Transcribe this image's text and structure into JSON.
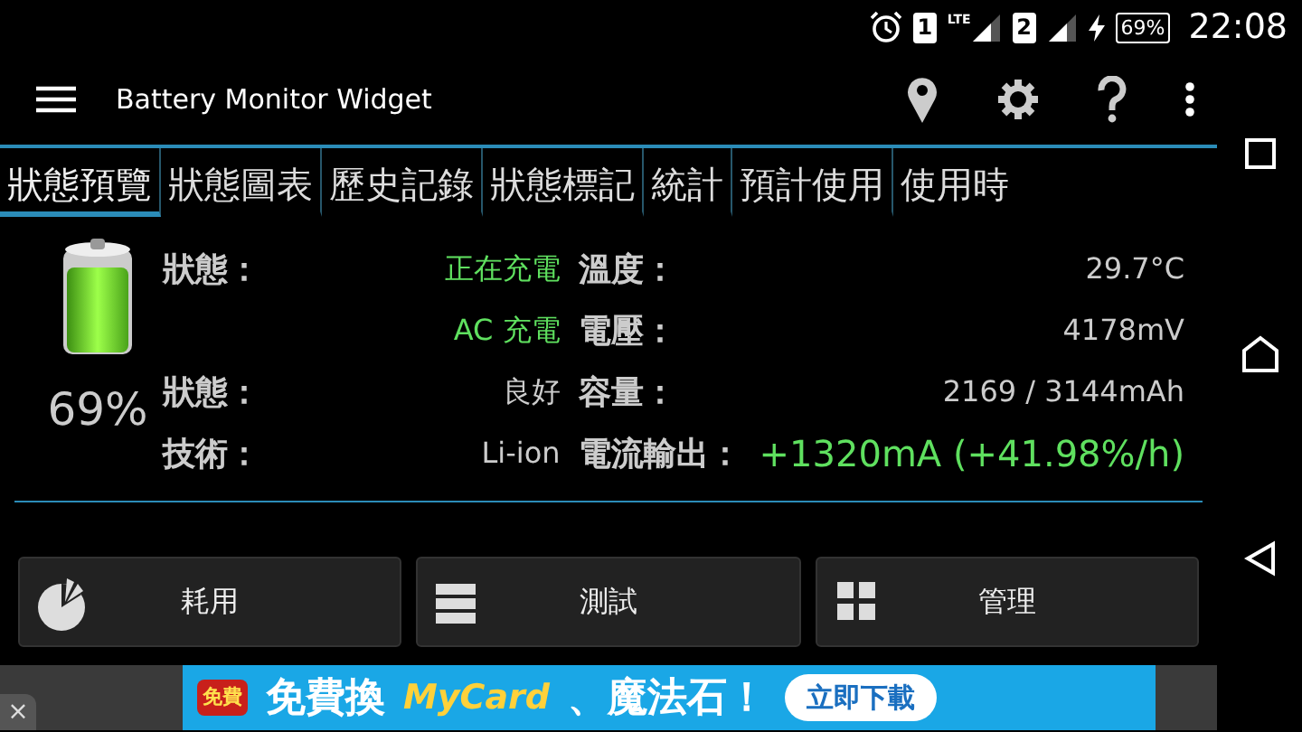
{
  "status_bar": {
    "sim_1": "1",
    "network": "LTE",
    "sim_2": "2",
    "battery": "69%",
    "time": "22:08"
  },
  "app_bar": {
    "title": "Battery Monitor Widget"
  },
  "tabs": [
    {
      "label": "狀態預覽",
      "selected": true
    },
    {
      "label": "狀態圖表",
      "selected": false
    },
    {
      "label": "歷史記錄",
      "selected": false
    },
    {
      "label": "狀態標記",
      "selected": false
    },
    {
      "label": "統計",
      "selected": false
    },
    {
      "label": "預計使用",
      "selected": false
    },
    {
      "label": "使用時",
      "selected": false
    }
  ],
  "battery": {
    "percent": "69%"
  },
  "details_left": [
    {
      "label": "狀態：",
      "value": "正在充電",
      "highlight": true
    },
    {
      "value": "AC 充電",
      "highlight": true
    },
    {
      "label": "狀態：",
      "value": "良好",
      "highlight": false
    },
    {
      "label": "技術：",
      "value": "Li-ion",
      "highlight": false
    }
  ],
  "details_right": [
    {
      "label": "溫度：",
      "value": "29.7°C",
      "highlight": false
    },
    {
      "label": "電壓：",
      "value": "4178mV",
      "highlight": false
    },
    {
      "label": "容量：",
      "value": "2169 / 3144mAh",
      "highlight": false
    },
    {
      "label": "電流輸出：",
      "value": "+1320mA (+41.98%/h)",
      "highlight": true
    }
  ],
  "buttons": [
    {
      "label": "耗用",
      "kind": "usage"
    },
    {
      "label": "測試",
      "kind": "test"
    },
    {
      "label": "管理",
      "kind": "manage"
    }
  ],
  "ad": {
    "badge": "免費",
    "headline": "免費換",
    "brand": "MyCard",
    "tail": "、魔法石！",
    "cta": "立即下載",
    "close": "×"
  }
}
